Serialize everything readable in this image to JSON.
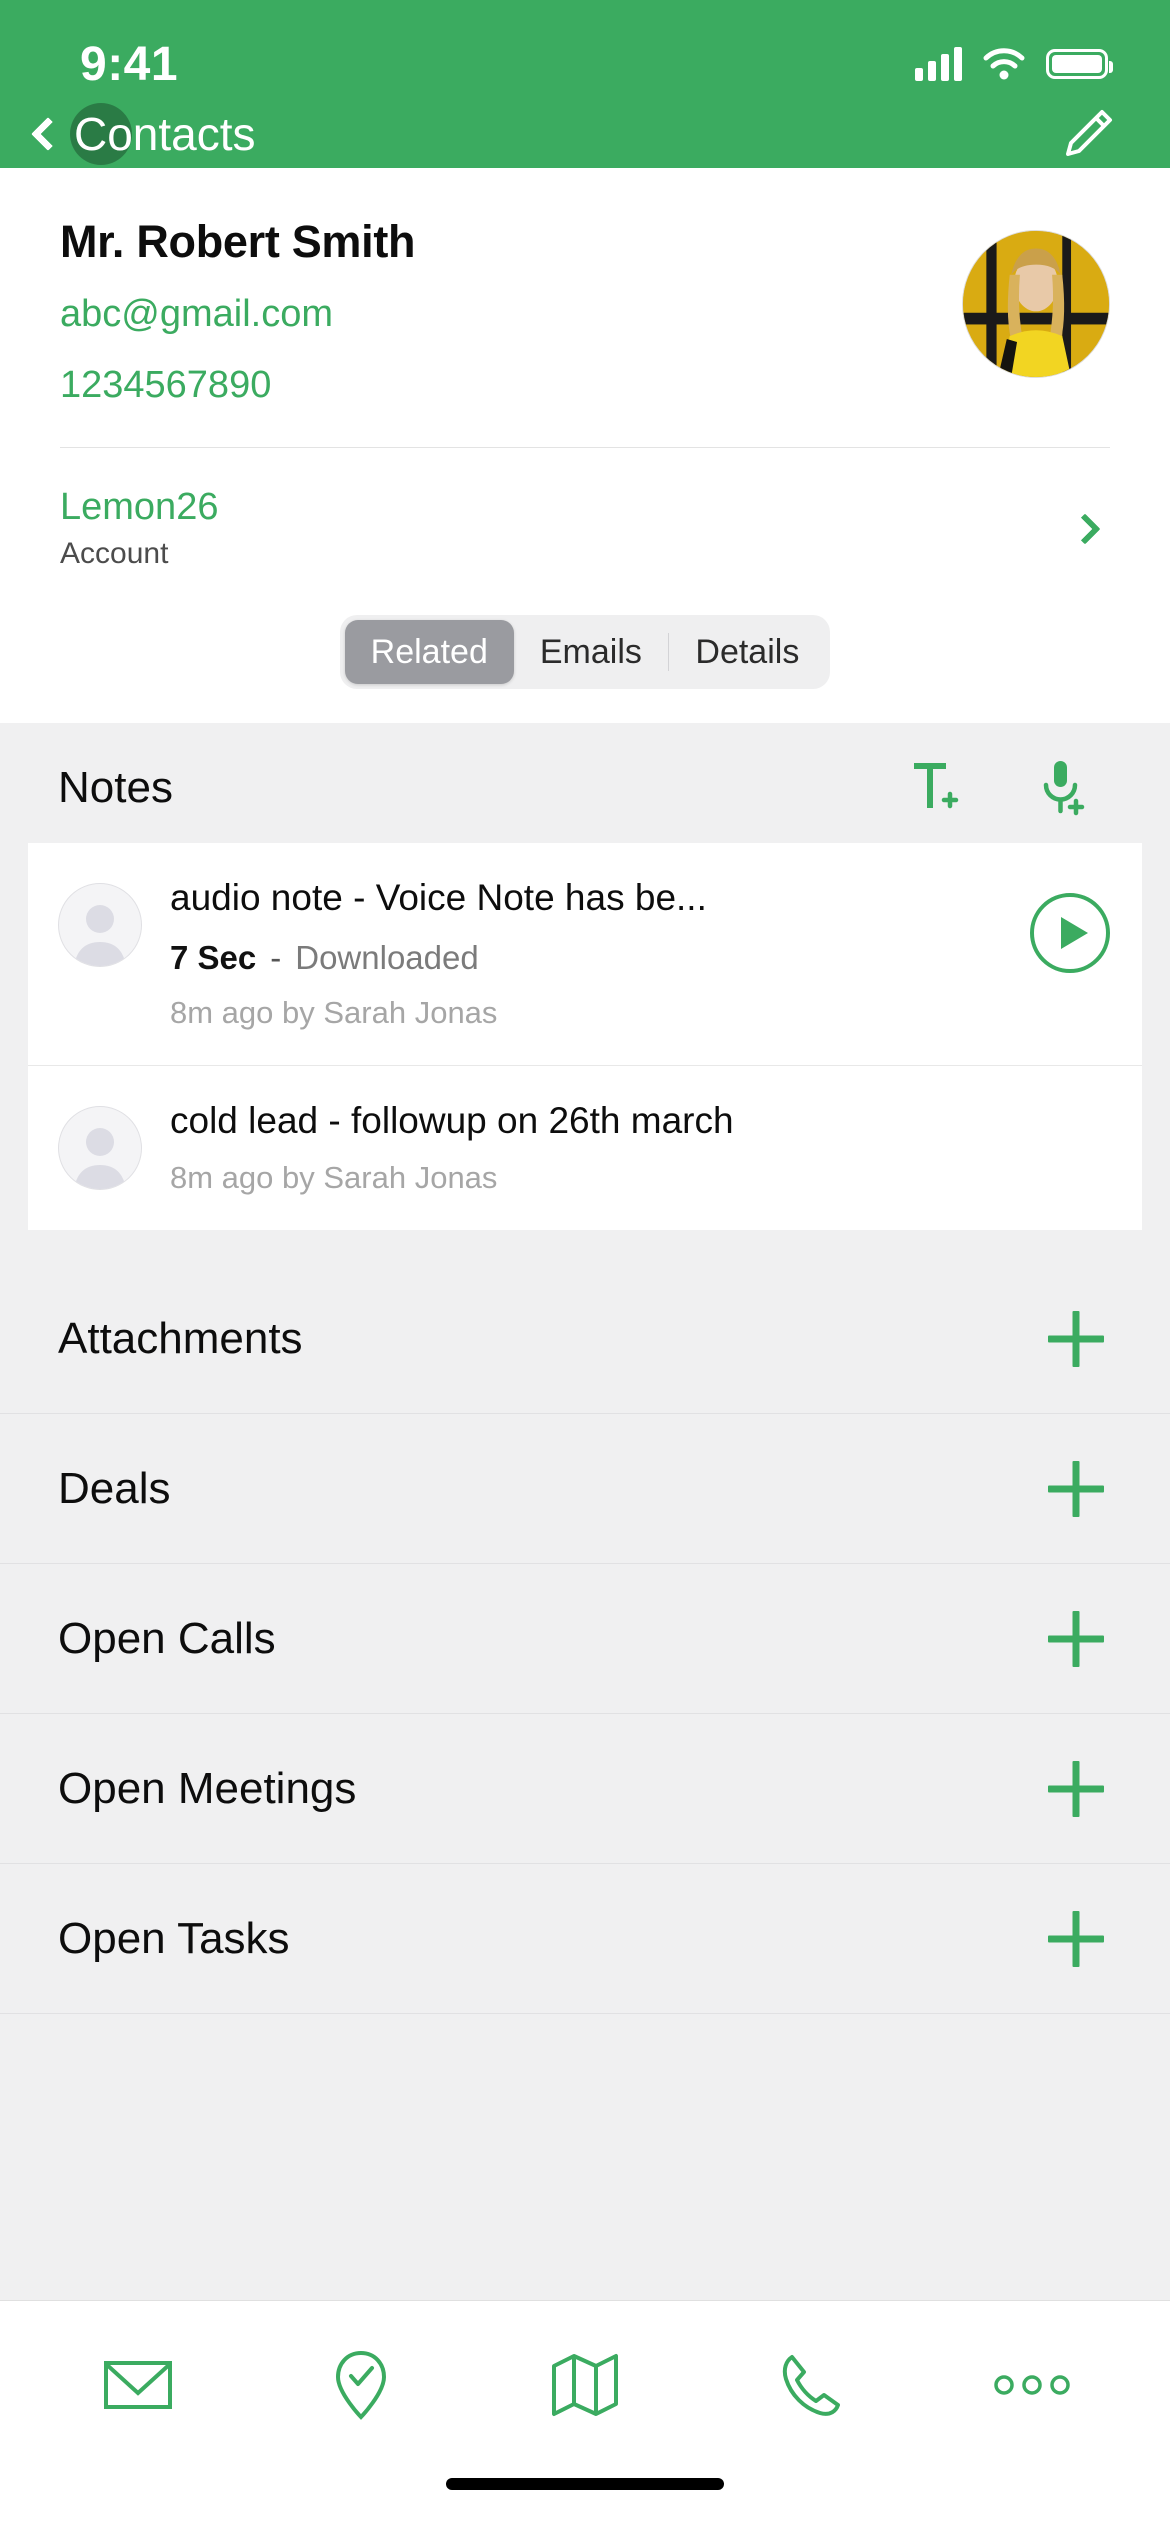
{
  "statusbar": {
    "time": "9:41",
    "cellular_icon": "cellular-bars-icon",
    "wifi_icon": "wifi-icon",
    "battery_icon": "battery-full-icon"
  },
  "navbar": {
    "back_icon": "chevron-left-icon",
    "title": "Contacts",
    "edit_icon": "pencil-edit-icon"
  },
  "contact": {
    "name": "Mr. Robert Smith",
    "email": "abc@gmail.com",
    "phone": "1234567890",
    "avatar_icon": "contact-photo"
  },
  "account": {
    "name": "Lemon26",
    "label": "Account",
    "chevron_icon": "chevron-right-icon"
  },
  "tabs": [
    {
      "label": "Related",
      "active": true
    },
    {
      "label": "Emails",
      "active": false
    },
    {
      "label": "Details",
      "active": false
    }
  ],
  "notes": {
    "title": "Notes",
    "add_text_icon": "add-text-note-icon",
    "add_voice_icon": "add-voice-note-icon",
    "items": [
      {
        "title": "audio note - Voice Note has be...",
        "duration": "7 Sec",
        "separator": "-",
        "status": "Downloaded",
        "subtitle": "8m ago by Sarah Jonas",
        "has_play": true,
        "play_icon": "play-circle-icon",
        "avatar_icon": "user-placeholder-icon"
      },
      {
        "title": "cold lead - followup on 26th march",
        "duration": "",
        "separator": "",
        "status": "",
        "subtitle": "8m ago by Sarah Jonas",
        "has_play": false,
        "play_icon": "",
        "avatar_icon": "user-placeholder-icon"
      }
    ]
  },
  "related_lists": [
    {
      "label": "Attachments",
      "add_icon": "plus-icon"
    },
    {
      "label": "Deals",
      "add_icon": "plus-icon"
    },
    {
      "label": "Open Calls",
      "add_icon": "plus-icon"
    },
    {
      "label": "Open Meetings",
      "add_icon": "plus-icon"
    },
    {
      "label": "Open Tasks",
      "add_icon": "plus-icon"
    }
  ],
  "tabbar": [
    {
      "icon": "envelope-icon"
    },
    {
      "icon": "location-check-icon"
    },
    {
      "icon": "map-icon"
    },
    {
      "icon": "phone-icon"
    },
    {
      "icon": "more-dots-icon"
    }
  ],
  "colors": {
    "brand_green": "#3BAB60",
    "segment_active": "#9A9BA0",
    "page_background": "#F0F0F1"
  }
}
